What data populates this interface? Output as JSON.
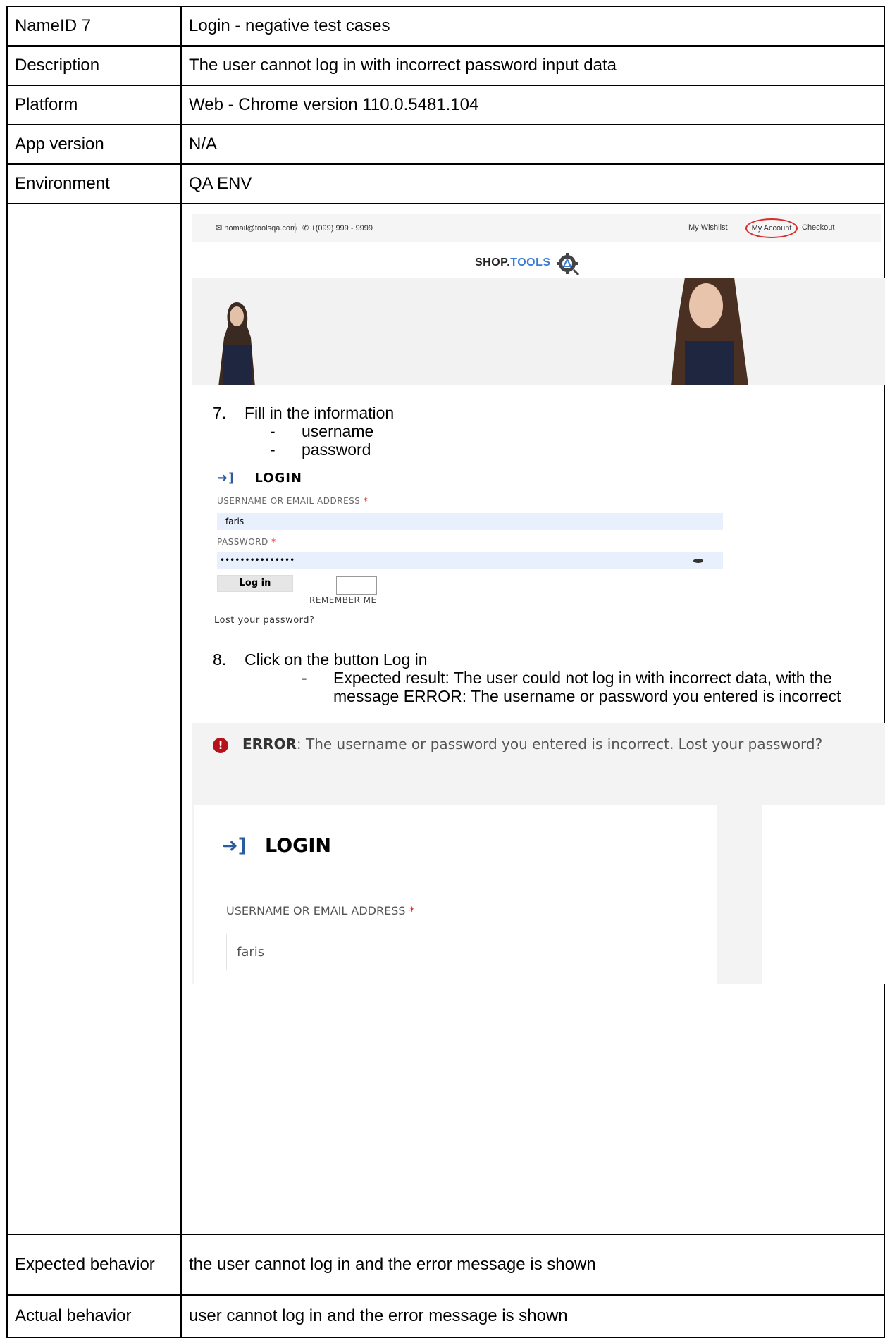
{
  "rows": [
    {
      "label": "NameID 7",
      "value": "Login - negative test cases"
    },
    {
      "label": "Description",
      "value": "The user cannot log in with incorrect password input data"
    },
    {
      "label": "Platform",
      "value": "Web - Chrome version 110.0.5481.104"
    },
    {
      "label": "App version",
      "value": "N/A"
    },
    {
      "label": "Environment",
      "value": "QA ENV"
    }
  ],
  "shot": {
    "topbar": {
      "email": "nomail@toolsqa.com",
      "phone": "+(099) 999 - 9999",
      "wishlist": "My Wishlist",
      "account": "My Account",
      "checkout": "Checkout"
    },
    "logo": {
      "part1": "SHOP.",
      "part2": "TOOLS"
    },
    "step7": {
      "number": "7.",
      "text": "Fill in the information",
      "items": [
        "username",
        "password"
      ]
    },
    "small_login": {
      "heading": "LOGIN",
      "username_label": "USERNAME OR EMAIL ADDRESS",
      "username_value": "faris",
      "password_label": "PASSWORD",
      "password_value": "•••••••••••••••",
      "button": "Log in",
      "remember": "REMEMBER ME",
      "lost": "Lost your password?"
    },
    "step8": {
      "number": "8.",
      "text": "Click on the button Log in",
      "expected": "Expected result: The user could not log in with incorrect data, with the message ERROR: The username or password you entered is incorrect"
    },
    "error_view": {
      "error_bold": "ERROR",
      "error_text": ": The username or password you entered is incorrect. Lost your password?",
      "heading": "LOGIN",
      "username_label": "USERNAME OR EMAIL ADDRESS",
      "username_value": "faris"
    }
  },
  "expected_behavior": {
    "label": "Expected behavior",
    "value": "the user cannot log in and the error message is shown"
  },
  "actual_behavior": {
    "label": "Actual behavior",
    "value": "user cannot log in and the error message is shown"
  }
}
